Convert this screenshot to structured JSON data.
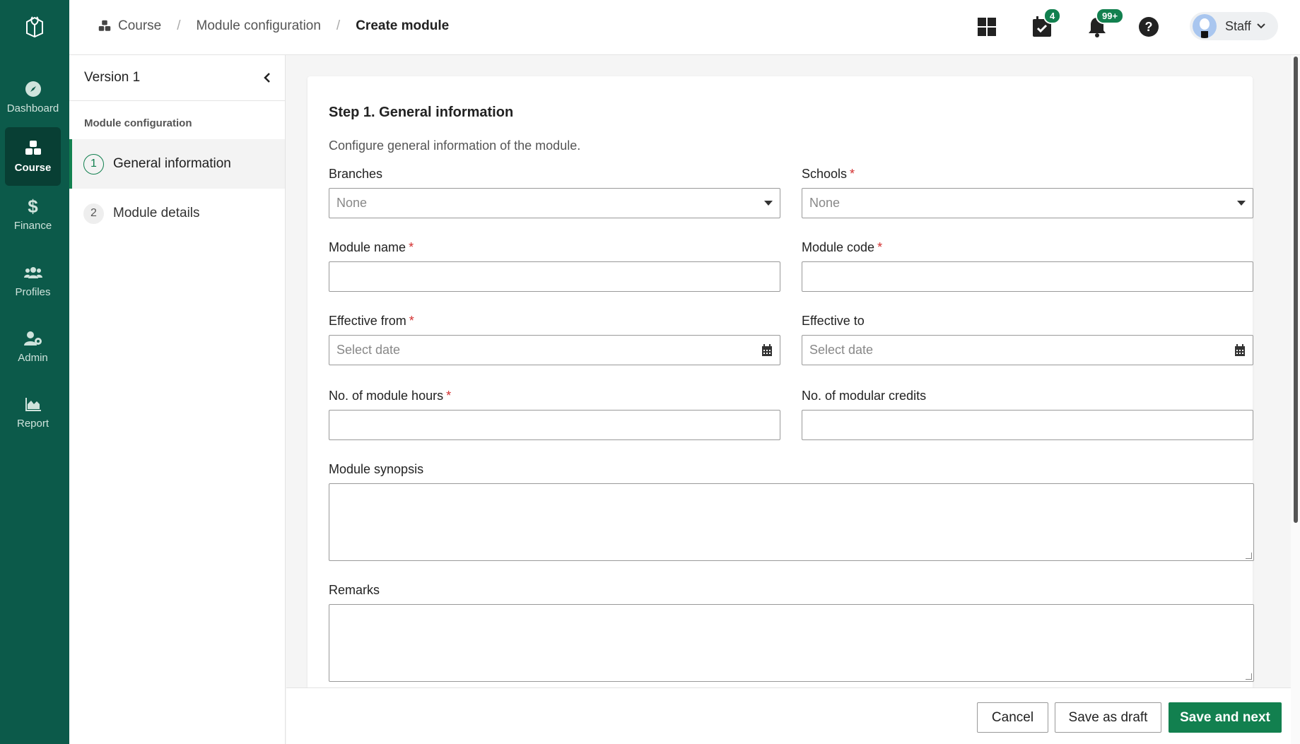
{
  "sidebar": {
    "logo": "app-logo",
    "items": [
      {
        "label": "Dashboard",
        "icon": "compass-icon"
      },
      {
        "label": "Course",
        "icon": "cubes-icon",
        "active": true
      },
      {
        "label": "Finance",
        "icon": "dollar-icon"
      },
      {
        "label": "Profiles",
        "icon": "users-icon"
      },
      {
        "label": "Admin",
        "icon": "user-cog-icon"
      },
      {
        "label": "Report",
        "icon": "area-chart-icon"
      }
    ]
  },
  "header": {
    "breadcrumb": [
      "Course",
      "Module configuration",
      "Create module"
    ],
    "breadcrumb_sep": "/",
    "calendar_badge": "4",
    "notification_badge": "99+",
    "user_label": "Staff"
  },
  "panel": {
    "version_label": "Version 1",
    "section_label": "Module configuration",
    "steps": [
      {
        "num": "1",
        "label": "General information",
        "active": true
      },
      {
        "num": "2",
        "label": "Module details",
        "active": false
      }
    ]
  },
  "form": {
    "title": "Step 1. General information",
    "description": "Configure general information of the module.",
    "fields": {
      "branches": {
        "label": "Branches",
        "value": "None",
        "required": false
      },
      "schools": {
        "label": "Schools",
        "value": "None",
        "required": true
      },
      "module_name": {
        "label": "Module name",
        "value": "",
        "required": true
      },
      "module_code": {
        "label": "Module code",
        "value": "",
        "required": true
      },
      "effective_from": {
        "label": "Effective from",
        "placeholder": "Select date",
        "required": true
      },
      "effective_to": {
        "label": "Effective to",
        "placeholder": "Select date",
        "required": false
      },
      "module_hours": {
        "label": "No. of module hours",
        "value": "",
        "required": true
      },
      "modular_credits": {
        "label": "No. of modular credits",
        "value": "",
        "required": false
      },
      "synopsis": {
        "label": "Module synopsis",
        "value": ""
      },
      "remarks": {
        "label": "Remarks",
        "value": ""
      }
    },
    "required_mark": "*"
  },
  "footer": {
    "cancel": "Cancel",
    "save_draft": "Save as draft",
    "save_next": "Save and next"
  },
  "colors": {
    "nav_bg": "#0c5a4a",
    "accent": "#12804f",
    "required": "#d32f2f"
  }
}
